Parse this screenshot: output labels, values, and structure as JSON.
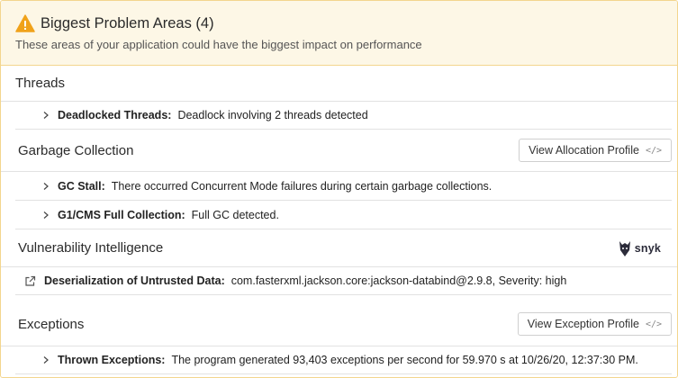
{
  "header": {
    "title": "Biggest Problem Areas (4)",
    "subtitle": "These areas of your application could have the biggest impact on performance"
  },
  "sections": {
    "threads": {
      "title": "Threads",
      "items": [
        {
          "label": "Deadlocked Threads:",
          "text": "Deadlock involving 2 threads detected"
        }
      ]
    },
    "gc": {
      "title": "Garbage Collection",
      "button": "View Allocation Profile",
      "items": [
        {
          "label": "GC Stall:",
          "text": "There occurred Concurrent Mode failures during certain garbage collections."
        },
        {
          "label": "G1/CMS Full Collection:",
          "text": "Full GC detected."
        }
      ]
    },
    "vuln": {
      "title": "Vulnerability Intelligence",
      "brand": "snyk",
      "items": [
        {
          "label": "Deserialization of Untrusted Data:",
          "text": "com.fasterxml.jackson.core:jackson-databind@2.9.8, Severity: high"
        }
      ]
    },
    "exceptions": {
      "title": "Exceptions",
      "button": "View Exception Profile",
      "items": [
        {
          "label": "Thrown Exceptions:",
          "text": "The program generated 93,403 exceptions per second for 59.970 s at 10/26/20, 12:37:30 PM."
        }
      ]
    }
  },
  "icons": {
    "warning": "warning-icon",
    "chevron": "chevron-right-icon",
    "code": "code-icon",
    "external": "external-link-icon",
    "snyk": "snyk-logo-icon"
  },
  "colors": {
    "header_bg": "#fdf7e6",
    "border": "#f3d58e",
    "warning": "#f0a21a"
  }
}
